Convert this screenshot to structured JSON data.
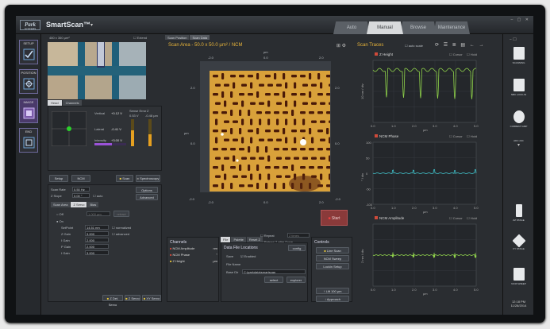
{
  "app": {
    "name": "SmartScan™",
    "logo_text": "Park",
    "logo_sub": "SYSTEMS"
  },
  "tabs": [
    "Auto",
    "Manual",
    "Browse",
    "Maintenance"
  ],
  "active_tab": "Manual",
  "nav": [
    "SETUP",
    "POSITION",
    "IMAGE",
    "END"
  ],
  "camera": {
    "size_label": "480 x 360 µm²",
    "extend_label": "Extend",
    "tabs": [
      "Head",
      "Channels"
    ]
  },
  "position_panel": {
    "vertical_label": "Vertical",
    "vertical_value": "+0.12 V",
    "sense_label": "Sense Error",
    "sense_value": "0.53 V",
    "z_label": "Z",
    "z_value": "-0.48 µm",
    "lateral_label": "Lateral",
    "lateral_value": "-0.41 V",
    "intensity_label": "Intensity",
    "intensity_value": "+3.00 V",
    "intensity_level": 0.55
  },
  "setup": {
    "setup_btn": "Setup",
    "mode_btn": "NCM",
    "scan_btn": "Scan",
    "spectro_btn": "Spectroscopy",
    "options_btn": "Options",
    "advanced_btn": "Advanced"
  },
  "scan_params": {
    "rate_label": "Scan Rate",
    "rate_value": "0.50 Hz",
    "slope_label": "Z Slope",
    "slope_value": "0.00 °",
    "auto_label": "auto",
    "subtabs": [
      "Scan Area",
      "Z Servo",
      "Bias"
    ],
    "off_label": "Off",
    "on_label": "On",
    "retract_label": "retract",
    "off_value": "1.000 µm",
    "setpoint_label": "SetPoint",
    "setpoint_value": "14.51 nm",
    "normalized_label": "normalized",
    "zgain_label": "Z Gain",
    "zgain_value": "3.000",
    "advanced_label": "advanced",
    "igain_label": "I Gain",
    "igain_value": "2.000",
    "pgain_label": "P Gain",
    "pgain_value": "2.000",
    "dgain_label": "I Gain",
    "dgain_value": "3.000",
    "servo_btns": [
      "Z Det. Servo",
      "Z Servo",
      "XY Servo"
    ]
  },
  "scan_area": {
    "tabs": [
      "Scan Position",
      "Scan Data"
    ],
    "title": "Scan Area  -  50.0 x 50.0 µm²  /  NCM",
    "x_unit": "µm",
    "y_unit": "µm",
    "x_ticks": [
      "-2.0",
      "0.0",
      "2.0"
    ],
    "y_ticks": [
      "2.0",
      "0.0",
      "-2.0"
    ],
    "repeat_label": "Repeat",
    "retract_label": "Retract Z after Done",
    "repeat_value": "2 times",
    "start_btn": "Start"
  },
  "channels": {
    "title": "Channels",
    "items": [
      {
        "name": "NCM Amplitude",
        "unit": "nm",
        "color": "#d04a3a"
      },
      {
        "name": "NCM Phase",
        "unit": "°",
        "color": "#d04a3a"
      },
      {
        "name": "Z Height",
        "unit": "µm",
        "color": "#e6c43a"
      }
    ]
  },
  "file": {
    "tabs": [
      "File",
      "Palette",
      "Reset Z"
    ],
    "title": "Data File Locations",
    "config_btn": "config",
    "save_label": "Save",
    "enabled_label": "Enabled",
    "filename_label": "File Name",
    "basedir_label": "Base Dir",
    "basedir_value": "C:\\parkdata\\smartscan",
    "select_btn": "select",
    "explorer_btn": "explorer"
  },
  "controls": {
    "title": "Controls",
    "line_scan": "Line Scan",
    "ncm_sweep": "NCM Sweep",
    "lockin": "Lockin Setup",
    "lift": "Lift 100 µm",
    "approach": "Approach"
  },
  "traces": {
    "title": "Scan Traces",
    "autoscale": "auto scale",
    "cursor": "Cursor",
    "hold": "Hold",
    "panels": [
      {
        "name": "Z Height",
        "unit": "10 nm / div",
        "color": "#8fd24a",
        "xticks": [
          "0.0",
          "1.0",
          "2.0",
          "3.0",
          "4.0",
          "5.0"
        ],
        "yticks": []
      },
      {
        "name": "NCM Phase",
        "unit": "° / div",
        "color": "#3fc0c8",
        "xticks": [
          "0.0",
          "1.0",
          "2.0",
          "3.0",
          "4.0",
          "5.0"
        ],
        "yticks": [
          "100",
          "50",
          "0",
          "-50",
          "-100"
        ]
      },
      {
        "name": "NCM Amplitude",
        "unit": "2 nm / div",
        "color": "#8fd24a",
        "xticks": [
          "0.0",
          "1.0",
          "2.0",
          "3.0",
          "4.0",
          "5.0"
        ],
        "yticks": []
      }
    ],
    "x_unit": "µm"
  },
  "right_tools": [
    "SCANNING",
    "NBC LOCK-IN",
    "CURRENT AMP",
    "ADC 24C",
    "ZZ STAGE",
    "XY STAGE",
    "NCM SWEEP"
  ],
  "clock": {
    "time": "12:18 PM",
    "date": "11/28/2014"
  }
}
